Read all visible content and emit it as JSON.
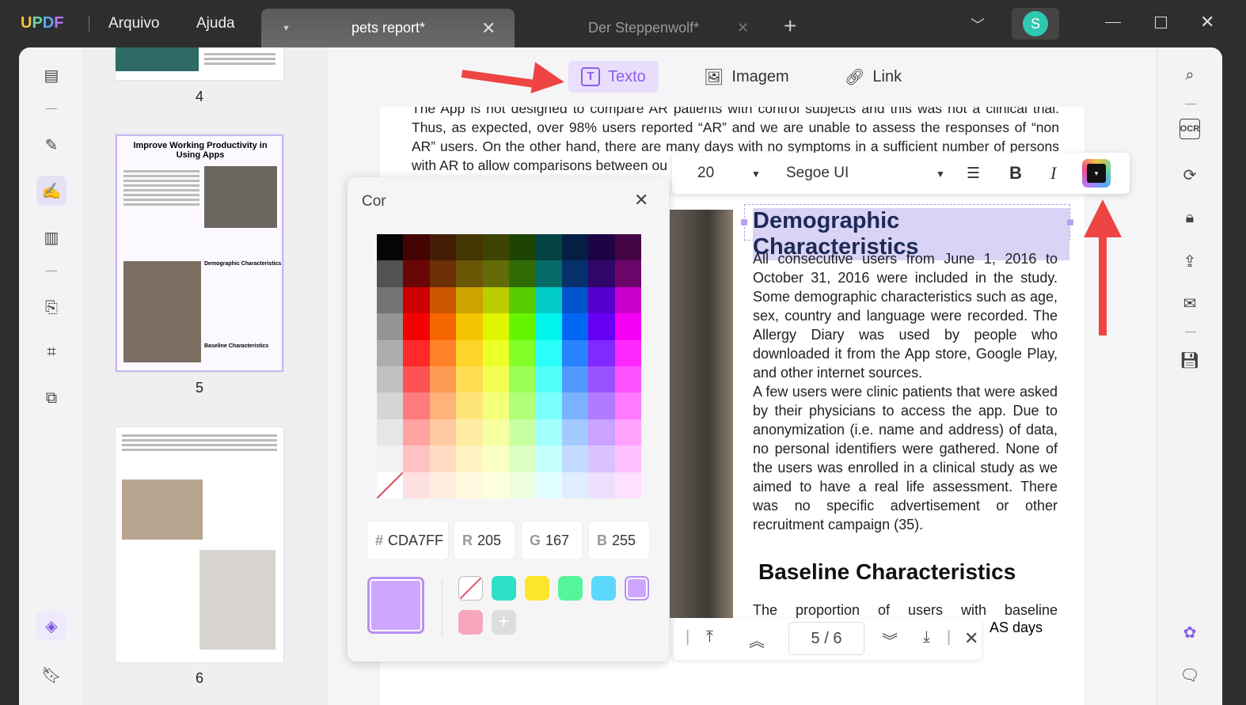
{
  "app": {
    "logo": "UPDF",
    "menu": [
      "Arquivo",
      "Ajuda"
    ],
    "avatar": "S"
  },
  "tabs": [
    {
      "label": "pets report*",
      "active": true
    },
    {
      "label": "Der Steppenwolf*",
      "active": false
    }
  ],
  "edit_toolbar": {
    "text": "Texto",
    "image": "Imagem",
    "link": "Link"
  },
  "format_bar": {
    "font_size": "20",
    "font_family": "Segoe UI",
    "bold": "B",
    "italic": "I",
    "color_icon": "color-swatch-icon"
  },
  "thumbnails": [
    {
      "page": "4"
    },
    {
      "page": "5",
      "title": "Improve Working Productivity in Using Apps",
      "headings": [
        "Demographic Characteristics",
        "Baseline Characteristics"
      ]
    },
    {
      "page": "6"
    }
  ],
  "document": {
    "top_text": "The App is not designed to compare AR patients with control subjects and this was not a clinical trial. Thus, as expected, over 98% users reported “AR” and we are unable to assess the responses of “non AR” users. On the other hand, there are many days with no symptoms in a sufficient number of persons with AR to allow comparisons between ou",
    "heading1": "Demographic Characteristics",
    "para1": "All consecutive users from June 1, 2016 to October 31, 2016 were included in the study. Some demographic characteristics such as age, sex, country and language were recorded. The Allergy Diary was used by people who downloaded it from the App store, Google Play, and other internet sources.",
    "para2": "A few users were clinic patients that were asked by their physicians to access the app. Due to anonymization (i.e. name and address) of data, no personal identifiers were gathered. None of the users was enrolled in a clinical study as we aimed to have a real life assessment. There was no specific advertisement or other recruitment campaign (35).",
    "heading2": "Baseline Characteristics",
    "para3": "The proportion of users with baseline",
    "para3b": "AS days"
  },
  "color_picker": {
    "title": "Cor",
    "hex": "CDA7FF",
    "r": "205",
    "g": "167",
    "b": "255",
    "hex_label": "#",
    "r_label": "R",
    "g_label": "G",
    "b_label": "B",
    "current": "#CDA7FF",
    "swatches": [
      "none",
      "#2ee0c8",
      "#fde52b",
      "#55f59c",
      "#5bd8fb",
      "#cda7ff",
      "#f7a6be"
    ]
  },
  "page_nav": {
    "current": "5",
    "total": "6",
    "sep": "/"
  },
  "colors": {
    "accent": "#8d5de8",
    "arrow": "#ef4444"
  }
}
